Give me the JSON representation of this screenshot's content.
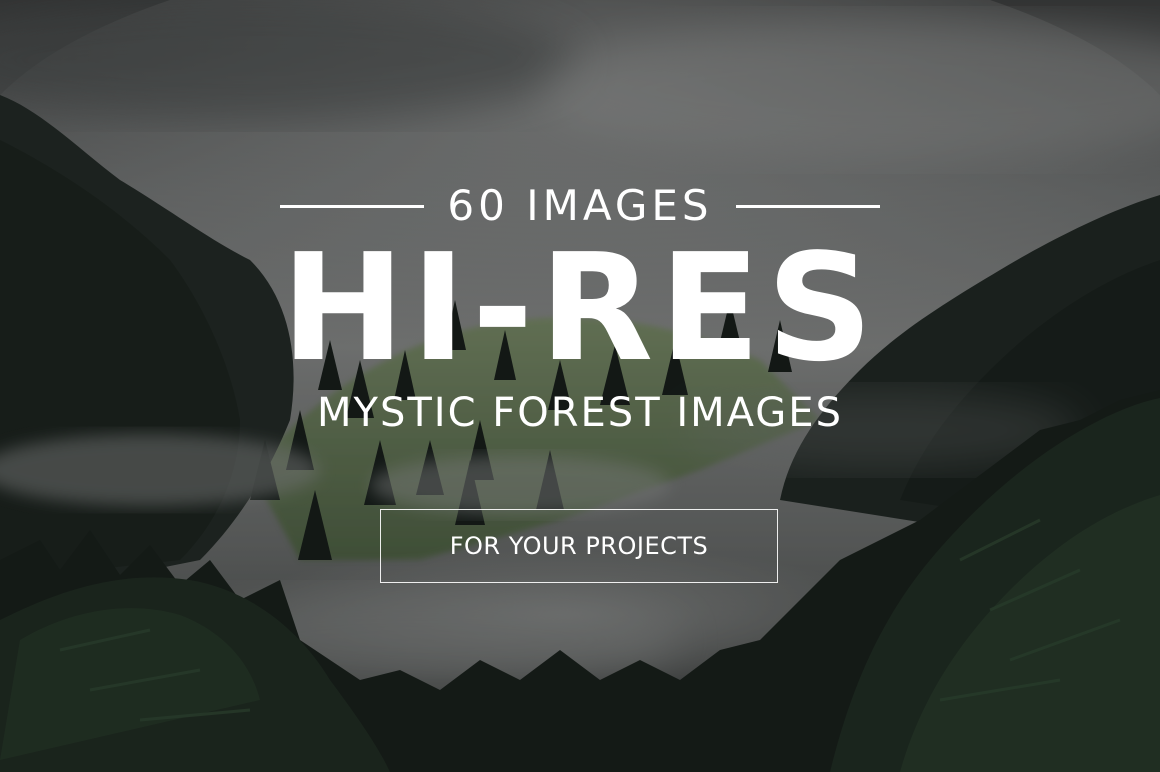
{
  "hero": {
    "count_text": "60 IMAGES",
    "headline": "HI-RES",
    "subline": "MYSTIC FOREST IMAGES",
    "cta_label": "FOR YOUR PROJECTS"
  },
  "colors": {
    "text": "#ffffff",
    "sky_fog": "#8f9190",
    "forest_dark": "#1b231f",
    "meadow": "#5f7a4c"
  }
}
